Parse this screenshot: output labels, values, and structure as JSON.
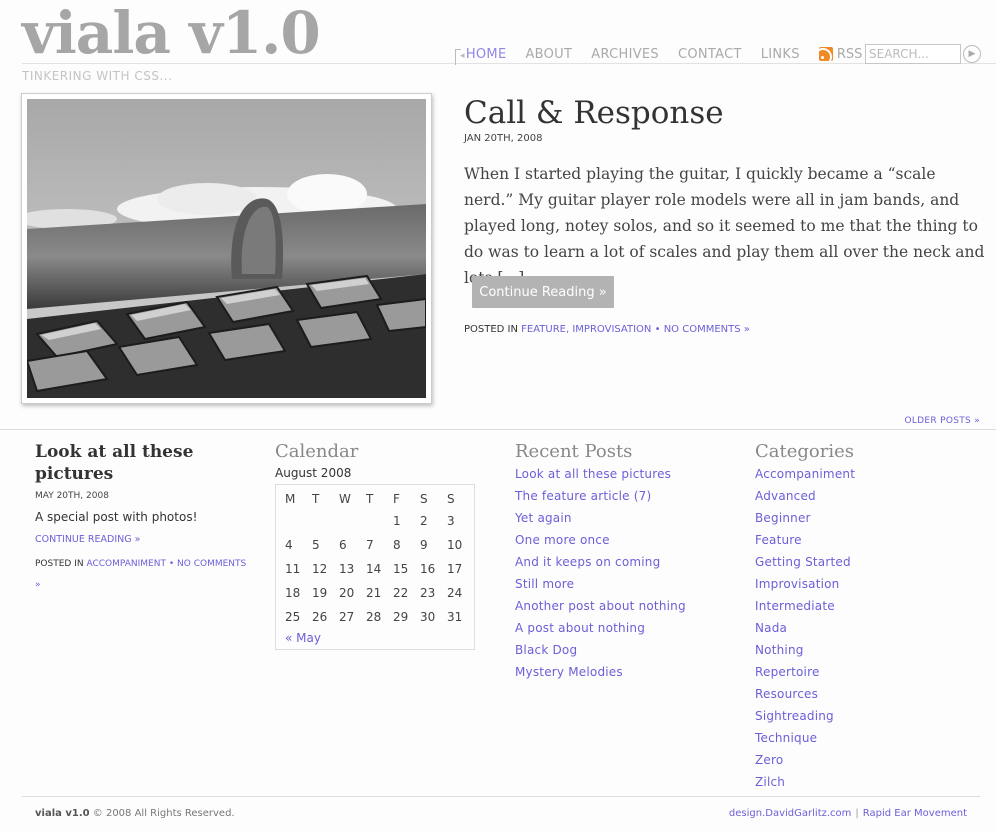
{
  "site": {
    "title": "viala v1.0",
    "tagline": "TINKERING WITH CSS..."
  },
  "nav": {
    "items": [
      {
        "label": "HOME",
        "active": true
      },
      {
        "label": "ABOUT"
      },
      {
        "label": "ARCHIVES"
      },
      {
        "label": "CONTACT"
      },
      {
        "label": "LINKS"
      }
    ],
    "rss_label": "RSS",
    "rss_icon": "rss-icon",
    "search_placeholder": "SEARCH...",
    "search_go_icon": "arrow-right-icon"
  },
  "featured": {
    "title": "Call & Response",
    "date": "JAN 20TH, 2008",
    "excerpt": "When I started playing the guitar, I quickly became a “scale nerd.” My guitar player role models were all in jam bands, and played long, notey solos, and so it seemed to me that the thing to do was to learn a lot of scales and play them all over the neck and lots [...]",
    "continue_label": "Continue Reading »",
    "posted_in_label": "POSTED IN",
    "categories": "FEATURE, IMPROVISATION",
    "separator": "•",
    "comments": "NO COMMENTS »"
  },
  "older_posts": "OLDER POSTS »",
  "mini_post": {
    "title": "Look at all these pictures",
    "date": "MAY 20TH, 2008",
    "excerpt": "A special post with photos!",
    "continue_label": "CONTINUE READING »",
    "posted_in_label": "POSTED IN",
    "category": "ACCOMPANIMENT",
    "separator": "•",
    "comments": "NO COMMENTS »"
  },
  "calendar": {
    "heading": "Calendar",
    "caption": "August 2008",
    "weekdays": [
      "M",
      "T",
      "W",
      "T",
      "F",
      "S",
      "S"
    ],
    "weeks": [
      [
        "",
        "",
        "",
        "",
        "1",
        "2",
        "3"
      ],
      [
        "4",
        "5",
        "6",
        "7",
        "8",
        "9",
        "10"
      ],
      [
        "11",
        "12",
        "13",
        "14",
        "15",
        "16",
        "17"
      ],
      [
        "18",
        "19",
        "20",
        "21",
        "22",
        "23",
        "24"
      ],
      [
        "25",
        "26",
        "27",
        "28",
        "29",
        "30",
        "31"
      ]
    ],
    "prev_label": "« May"
  },
  "recent_posts": {
    "heading": "Recent Posts",
    "items": [
      "Look at all these pictures",
      "The feature article (7)",
      "Yet again",
      "One more once",
      "And it keeps on coming",
      "Still more",
      "Another post about nothing",
      "A post about nothing",
      "Black Dog",
      "Mystery Melodies"
    ]
  },
  "categories": {
    "heading": "Categories",
    "items": [
      "Accompaniment",
      "Advanced",
      "Beginner",
      "Feature",
      "Getting Started",
      "Improvisation",
      "Intermediate",
      "Nada",
      "Nothing",
      "Repertoire",
      "Resources",
      "Sightreading",
      "Technique",
      "Zero",
      "Zilch"
    ]
  },
  "footer": {
    "site_name": "viala v1.0",
    "copyright": "© 2008 All Rights Reserved.",
    "credit_1": "design.DavidGarlitz.com",
    "credit_sep": "|",
    "credit_2": "Rapid Ear Movement"
  },
  "colors": {
    "link": "#6b5fd8",
    "logo": "#a6a6a6",
    "button": "#b3b3b3",
    "rss": "#f08a24"
  }
}
